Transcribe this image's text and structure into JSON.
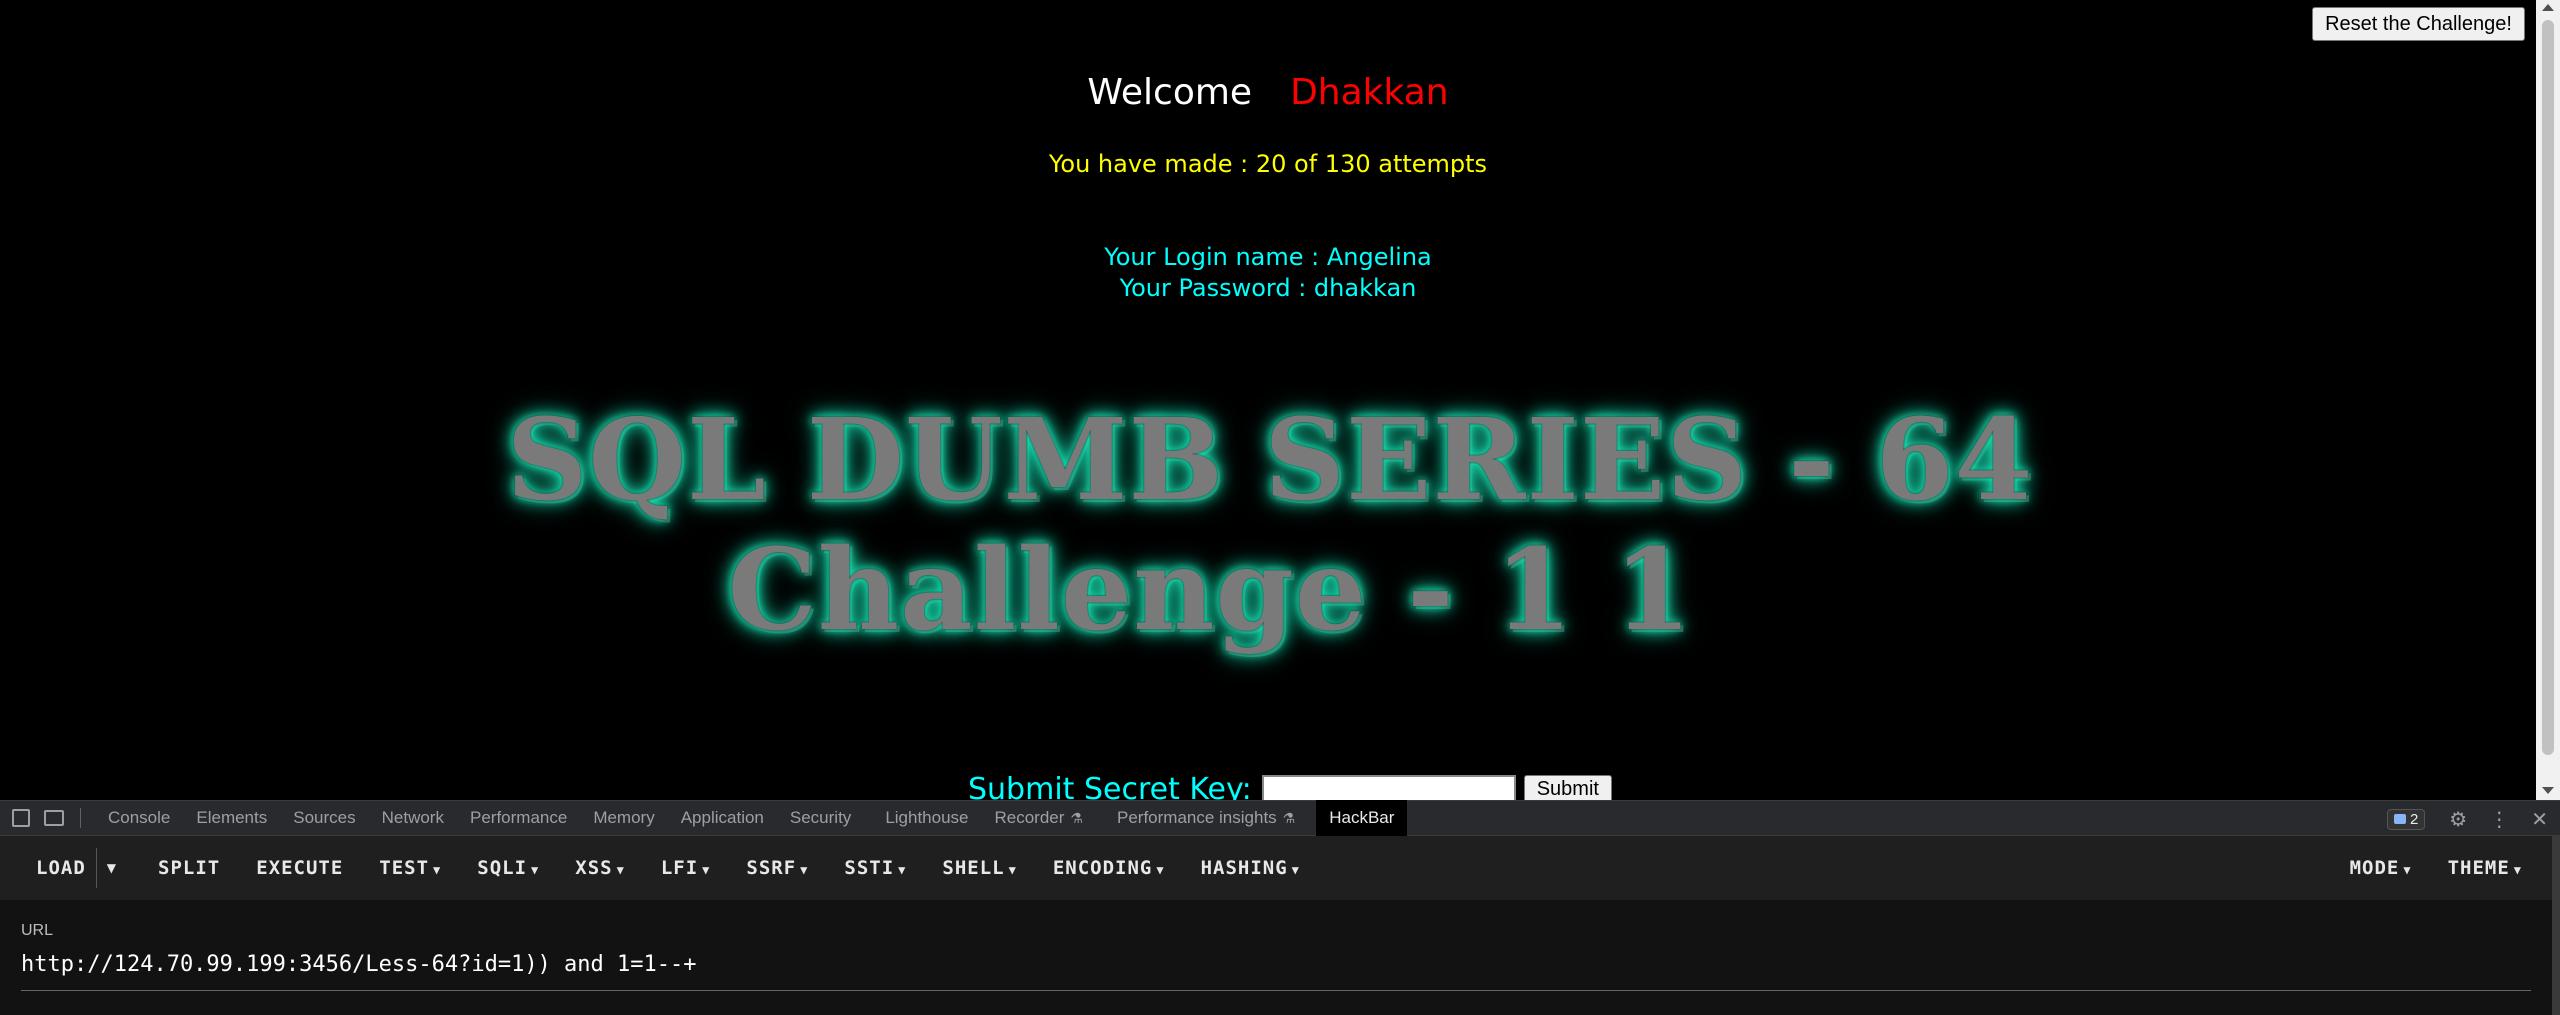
{
  "page": {
    "reset_button": "Reset the Challenge!",
    "welcome": "Welcome",
    "user": "Dhakkan",
    "attempts": "You have made : 20 of 130 attempts",
    "login_name": "Your Login name : Angelina",
    "password": "Your Password : dhakkan",
    "banner_line1": "SQL DUMB SERIES - 64",
    "banner_line2": "Challenge - 1 1",
    "secret_label": "Submit Secret Key:",
    "secret_value": "",
    "submit_button": "Submit"
  },
  "devtools": {
    "tabs": [
      "Console",
      "Elements",
      "Sources",
      "Network",
      "Performance",
      "Memory",
      "Application",
      "Security",
      "Lighthouse",
      "Recorder",
      "Performance insights",
      "HackBar"
    ],
    "active_tab": "HackBar",
    "issues_count": "2"
  },
  "hackbar": {
    "buttons": [
      "LOAD",
      "SPLIT",
      "EXECUTE",
      "TEST",
      "SQLI",
      "XSS",
      "LFI",
      "SSRF",
      "SSTI",
      "SHELL",
      "ENCODING",
      "HASHING"
    ],
    "right_buttons": [
      "MODE",
      "THEME"
    ],
    "url_label": "URL",
    "url_value": "http://124.70.99.199:3456/Less-64?id=1)) and 1=1--+"
  },
  "colors": {
    "welcome": "#ffffff",
    "user": "#ff0000",
    "attempts": "#ffff00",
    "login": "#00ffff",
    "banner_glow": "#19e3b3"
  }
}
